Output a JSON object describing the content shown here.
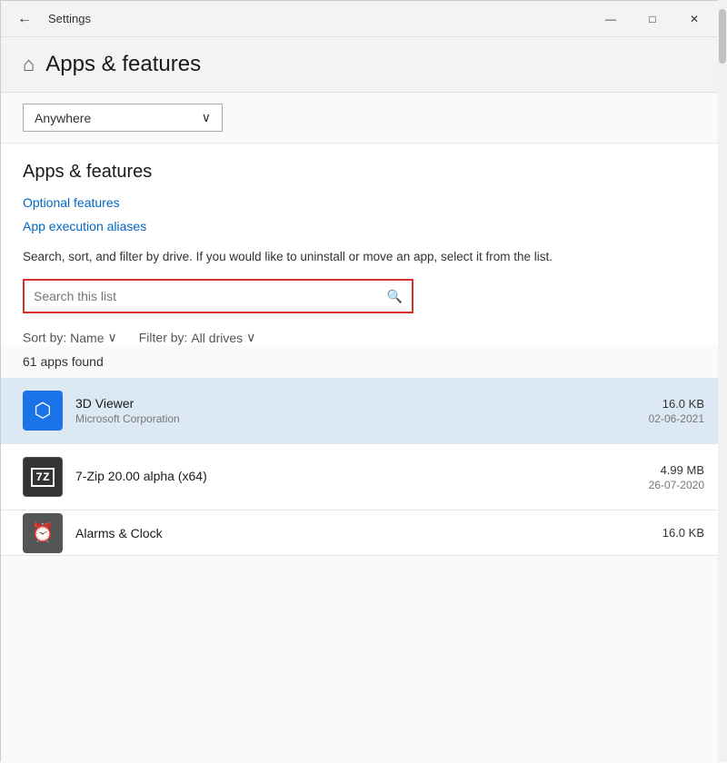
{
  "titlebar": {
    "title": "Settings",
    "back_label": "←",
    "minimize_label": "—",
    "maximize_label": "□",
    "close_label": "✕"
  },
  "header": {
    "icon": "⌂",
    "title": "Apps & features"
  },
  "dropdown": {
    "value": "Anywhere",
    "chevron": "∨"
  },
  "section": {
    "title": "Apps & features",
    "optional_features_label": "Optional features",
    "app_execution_aliases_label": "App execution aliases",
    "description": "Search, sort, and filter by drive. If you would like to uninstall or move an app, select it from the list.",
    "search_placeholder": "Search this list",
    "search_icon": "🔍"
  },
  "sort_filter": {
    "sort_label": "Sort by:",
    "sort_value": "Name",
    "sort_chevron": "∨",
    "filter_label": "Filter by:",
    "filter_value": "All drives",
    "filter_chevron": "∨"
  },
  "apps_found": {
    "count": "61",
    "label": "apps found"
  },
  "apps": [
    {
      "name": "3D Viewer",
      "publisher": "Microsoft Corporation",
      "size": "16.0 KB",
      "date": "02-06-2021",
      "icon_type": "3dviewer",
      "icon_label": "⬡"
    },
    {
      "name": "7-Zip 20.00 alpha (x64)",
      "publisher": "",
      "size": "4.99 MB",
      "date": "26-07-2020",
      "icon_type": "7zip",
      "icon_label": "7Z"
    },
    {
      "name": "Alarms & Clock",
      "publisher": "",
      "size": "16.0 KB",
      "date": "",
      "icon_type": "alarms",
      "icon_label": "⏰"
    }
  ]
}
